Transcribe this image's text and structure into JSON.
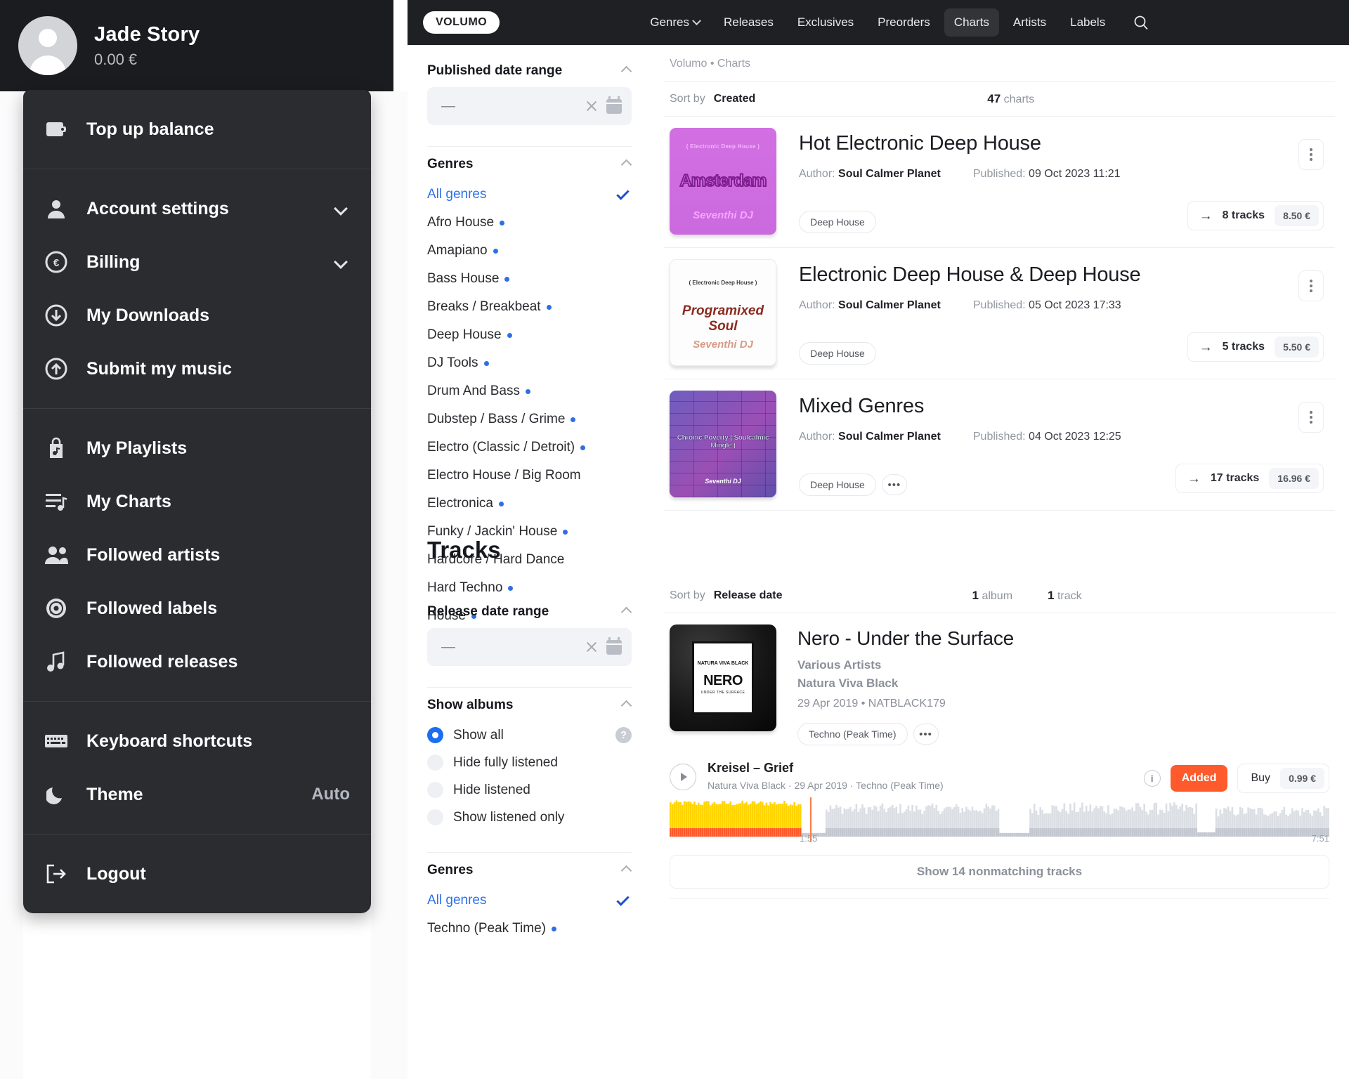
{
  "user": {
    "name": "Jade Story",
    "balance": "0.00 €",
    "avatar_icon": "user-avatar-icon"
  },
  "user_menu": {
    "groups": [
      {
        "items": [
          {
            "label": "Top up balance",
            "icon": "wallet-icon"
          }
        ]
      },
      {
        "items": [
          {
            "label": "Account settings",
            "icon": "person-icon",
            "chevron": true
          },
          {
            "label": "Billing",
            "icon": "coin-euro-icon",
            "chevron": true
          },
          {
            "label": "My Downloads",
            "icon": "download-circle-icon"
          },
          {
            "label": "Submit my music",
            "icon": "upload-circle-icon"
          }
        ]
      },
      {
        "items": [
          {
            "label": "My Playlists",
            "icon": "playlist-bag-icon"
          },
          {
            "label": "My Charts",
            "icon": "charts-list-icon"
          },
          {
            "label": "Followed artists",
            "icon": "users-icon"
          },
          {
            "label": "Followed labels",
            "icon": "vinyl-disc-icon"
          },
          {
            "label": "Followed releases",
            "icon": "music-note-icon"
          }
        ]
      },
      {
        "items": [
          {
            "label": "Keyboard shortcuts",
            "icon": "keyboard-icon"
          },
          {
            "label": "Theme",
            "icon": "moon-icon",
            "value": "Auto"
          }
        ]
      },
      {
        "items": [
          {
            "label": "Logout",
            "icon": "logout-icon"
          }
        ]
      }
    ]
  },
  "topnav": {
    "logo": "VOLUMO",
    "links": [
      {
        "label": "Genres",
        "has_chevron": true,
        "active": false
      },
      {
        "label": "Releases",
        "has_chevron": false,
        "active": false
      },
      {
        "label": "Exclusives",
        "has_chevron": false,
        "active": false
      },
      {
        "label": "Preorders",
        "has_chevron": false,
        "active": false
      },
      {
        "label": "Charts",
        "has_chevron": false,
        "active": true
      },
      {
        "label": "Artists",
        "has_chevron": false,
        "active": false
      },
      {
        "label": "Labels",
        "has_chevron": false,
        "active": false
      }
    ],
    "search_icon": "search-icon"
  },
  "charts_section": {
    "breadcrumb": {
      "root": "Volumo",
      "sep": "•",
      "current": "Charts"
    },
    "sort": {
      "label": "Sort by",
      "value": "Created"
    },
    "count": {
      "number": "47",
      "unit": "charts"
    },
    "filters": {
      "date_block": {
        "title": "Published date range",
        "value": "—",
        "clear_icon": "close-icon",
        "calendar_icon": "calendar-icon"
      },
      "genres_block": {
        "title": "Genres",
        "all_label": "All genres",
        "items": [
          "Afro House",
          "Amapiano",
          "Bass House",
          "Breaks / Breakbeat",
          "Deep House",
          "DJ Tools",
          "Drum And Bass",
          "Dubstep / Bass / Grime",
          "Electro (Classic / Detroit)",
          "Electro House / Big Room",
          "Electronica",
          "Funky / Jackin' House",
          "Hardcore / Hard Dance",
          "Hard Techno",
          "House"
        ],
        "items_no_dot": [
          "Electro House / Big Room",
          "Hardcore / Hard Dance"
        ]
      }
    },
    "items": [
      {
        "title": "Hot Electronic Deep House",
        "author_label": "Author:",
        "author": "Soul Calmer Planet",
        "published_label": "Published:",
        "published": "09 Oct 2023 11:21",
        "tags": [
          "Deep House"
        ],
        "has_tag_more": false,
        "tracks": "8 tracks",
        "price": "8.50 €",
        "art_style": "amsterdam",
        "art_text_top": "( Electronic Deep House )",
        "art_text_mid": "Amsterdam",
        "art_text_bottom": "Seventhi DJ"
      },
      {
        "title": "Electronic Deep House & Deep House",
        "author_label": "Author:",
        "author": "Soul Calmer Planet",
        "published_label": "Published:",
        "published": "05 Oct 2023 17:33",
        "tags": [
          "Deep House"
        ],
        "has_tag_more": false,
        "tracks": "5 tracks",
        "price": "5.50 €",
        "art_style": "programixed",
        "art_text_top": "( Electronic Deep House )",
        "art_text_mid": "Programixed Soul",
        "art_text_bottom": "Seventhi DJ"
      },
      {
        "title": "Mixed Genres",
        "author_label": "Author:",
        "author": "Soul Calmer Planet",
        "published_label": "Published:",
        "published": "04 Oct 2023 12:25",
        "tags": [
          "Deep House"
        ],
        "has_tag_more": true,
        "tracks": "17 tracks",
        "price": "16.96 €",
        "art_style": "brick",
        "art_text_top": "",
        "art_text_mid": "Chronic Poverty ( Soulcalmic Mingle )",
        "art_text_bottom": "Seventhi DJ"
      }
    ]
  },
  "tracks_section": {
    "heading": "Tracks",
    "filters": {
      "date_block": {
        "title": "Release date range",
        "value": "—",
        "clear_icon": "close-icon",
        "calendar_icon": "calendar-icon"
      },
      "albums_block": {
        "title": "Show albums",
        "help_icon": "help-icon",
        "options": [
          {
            "label": "Show all",
            "selected": true
          },
          {
            "label": "Hide fully listened",
            "selected": false
          },
          {
            "label": "Hide listened",
            "selected": false
          },
          {
            "label": "Show listened only",
            "selected": false
          }
        ]
      },
      "genres_block": {
        "title": "Genres",
        "all_label": "All genres",
        "items": [
          "Techno (Peak Time)"
        ]
      }
    },
    "sort": {
      "label": "Sort by",
      "value": "Release date"
    },
    "counts": [
      {
        "number": "1",
        "unit": "album"
      },
      {
        "number": "1",
        "unit": "track"
      }
    ],
    "release": {
      "title": "Nero - Under the Surface",
      "artist": "Various Artists",
      "label": "Natura Viva Black",
      "date_catalog": "29 Apr 2019 • NATBLACK179",
      "tags": [
        "Techno (Peak Time)"
      ],
      "has_tag_more": true,
      "art_line1": "NATURA VIVA BLACK",
      "art_title": "NERO",
      "art_sub": "UNDER THE SURFACE"
    },
    "track": {
      "play_icon": "play-icon",
      "name": "Kreisel – Grief",
      "meta": "Natura Viva Black · 29 Apr 2019 · Techno (Peak Time)",
      "info_icon": "info-icon",
      "added_label": "Added",
      "buy_label": "Buy",
      "price": "0.99 €",
      "time_current": "1:55",
      "time_total": "7:51",
      "accent_color": "#ff5a2b",
      "wave_played_color": "#ffd400"
    },
    "nonmatching_button": "Show 14 nonmatching tracks"
  }
}
